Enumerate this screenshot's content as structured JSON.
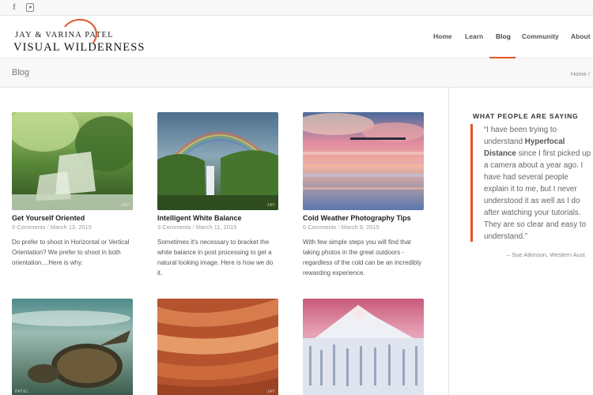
{
  "topbar": {
    "icons": [
      "facebook-icon",
      "youtube-icon"
    ]
  },
  "logo": {
    "line1": "JAY & VARINA   PATEL",
    "line2": "VISUAL WILDERNESS"
  },
  "nav": [
    {
      "label": "Home",
      "active": false
    },
    {
      "label": "Learn",
      "active": false
    },
    {
      "label": "Blog",
      "active": true
    },
    {
      "label": "Community",
      "active": false
    },
    {
      "label": "About",
      "active": false
    }
  ],
  "page": {
    "title": "Blog",
    "breadcrumb": "Home  /"
  },
  "posts": [
    {
      "title": "Get Yourself Oriented",
      "comments": "0 Comments",
      "date": "March 13, 2015",
      "excerpt": "Do prefer to shoot in Horizontal or Vertical Orientation? We prefer to shoot in both orientation....Here is why.",
      "watermark": "JAY"
    },
    {
      "title": "Intelligent White Balance",
      "comments": "3 Comments",
      "date": "March 11, 2015",
      "excerpt": "Sometimes it's necessary to bracket the white balance in post processing to get a natural looking image. Here is how we do it.",
      "watermark": "JAY"
    },
    {
      "title": "Cold Weather Photography Tips",
      "comments": "0 Comments",
      "date": "March 9, 2015",
      "excerpt": "With few simple steps you will find that taking photos in the great outdoors - regardless of the cold can be an incredibly rewarding experience.",
      "watermark": ""
    },
    {
      "title": "",
      "comments": "",
      "date": "",
      "excerpt": "",
      "watermark": "PATEL"
    },
    {
      "title": "",
      "comments": "",
      "date": "",
      "excerpt": "",
      "watermark": "JAY"
    },
    {
      "title": "",
      "comments": "",
      "date": "",
      "excerpt": "",
      "watermark": ""
    }
  ],
  "sidebar": {
    "widget_title": "WHAT PEOPLE ARE SAYING",
    "quote_pre": "“I have been trying to understand ",
    "quote_bold": "Hyperfocal Distance",
    "quote_post": " since I first picked up a camera about a year ago. I have had several people explain it to me, but I never understood it as well as I do after watching your tutorials. They are so clear and easy to understand.”",
    "author": "– Sue Atkinson, Western Aust"
  },
  "colors": {
    "accent": "#e5532b",
    "bar_bg": "#f8f8f8",
    "border": "#e6e6e6"
  }
}
